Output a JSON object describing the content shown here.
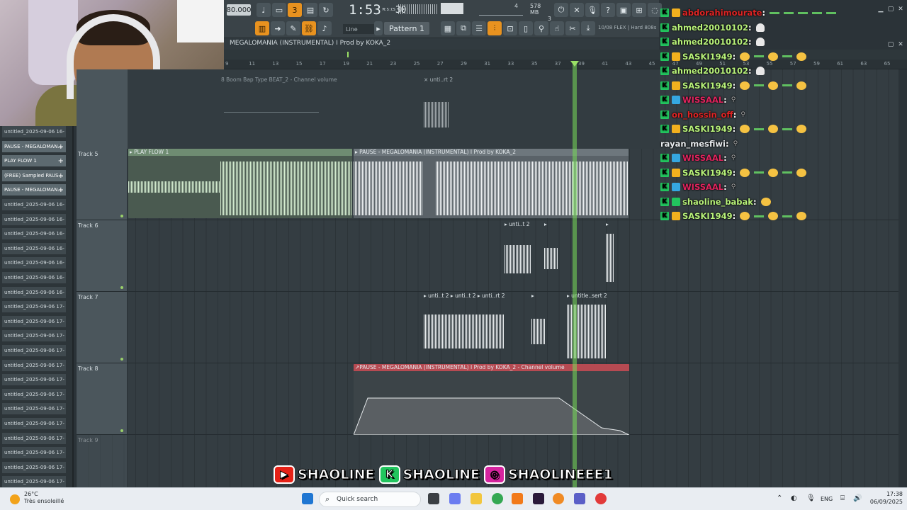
{
  "toolbar": {
    "tempo": "80.000",
    "time": "1:53",
    "time_frac": "30",
    "time_unit": "M:S:CS",
    "memory": "578 MB",
    "memory_sub": "3",
    "cpu_count": "4",
    "pattern": "Pattern 1",
    "snap": "Line",
    "flex_info": "10/08  FLEX | Hard 808s"
  },
  "window_title": "MEGALOMANIA (INSTRUMENTAL) I Prod by KOKA_2",
  "ruler": [
    "9",
    "11",
    "13",
    "15",
    "17",
    "19",
    "21",
    "23",
    "25",
    "27",
    "29",
    "31",
    "33",
    "35",
    "37",
    "39",
    "41",
    "43",
    "45",
    "47",
    "49",
    "51",
    "53",
    "55",
    "57",
    "59",
    "61",
    "63",
    "65"
  ],
  "browser": {
    "items": [
      {
        "label": "untitled_2025-09-06 16-",
        "hl": false
      },
      {
        "label": "PAUSE - MEGALOMAN...",
        "hl": true
      },
      {
        "label": "PLAY FLOW 1",
        "hl": true
      },
      {
        "label": "(FREE) Sampled PAUS...",
        "hl": true
      },
      {
        "label": "PAUSE - MEGALOMAN...",
        "hl": true
      },
      {
        "label": "untitled_2025-09-06 16-",
        "hl": false
      },
      {
        "label": "untitled_2025-09-06 16-",
        "hl": false
      },
      {
        "label": "untitled_2025-09-06 16-",
        "hl": false
      },
      {
        "label": "untitled_2025-09-06 16-",
        "hl": false
      },
      {
        "label": "untitled_2025-09-06 16-",
        "hl": false
      },
      {
        "label": "untitled_2025-09-06 16-",
        "hl": false
      },
      {
        "label": "untitled_2025-09-06 16-",
        "hl": false
      },
      {
        "label": "untitled_2025-09-06 17-",
        "hl": false
      },
      {
        "label": "untitled_2025-09-06 17-",
        "hl": false
      },
      {
        "label": "untitled_2025-09-06 17-",
        "hl": false
      },
      {
        "label": "untitled_2025-09-06 17-",
        "hl": false
      },
      {
        "label": "untitled_2025-09-06 17-",
        "hl": false
      },
      {
        "label": "untitled_2025-09-06 17-",
        "hl": false
      },
      {
        "label": "untitled_2025-09-06 17-",
        "hl": false
      },
      {
        "label": "untitled_2025-09-06 17-",
        "hl": false
      },
      {
        "label": "untitled_2025-09-06 17-",
        "hl": false
      },
      {
        "label": "untitled_2025-09-06 17-",
        "hl": false
      },
      {
        "label": "untitled_2025-09-06 17-",
        "hl": false
      },
      {
        "label": "untitled_2025-09-06 17-",
        "hl": false
      },
      {
        "label": "untitled_2025-09-06 17-",
        "hl": false
      }
    ]
  },
  "tracks": {
    "t5": "Track 5",
    "t6": "Track 6",
    "t7": "Track 7",
    "t8": "Track 8",
    "t9": "Track 9"
  },
  "clips": {
    "automation_top": "8 Boom Bap Type BEAT_2 - Channel volume",
    "top_small": "× unti..rt 2",
    "play_flow": "▸ PLAY FLOW 1",
    "pause_main": "▸ PAUSE - MEGALOMANIA (INSTRUMENTAL) I Prod by KOKA_2",
    "t6_a": "▸ unti..t 2",
    "t6_b": "▸",
    "t6_c": "▸",
    "t7_a": "▸ unti..t 2 ▸ unti..t 2 ▸ unti..rt 2",
    "t7_b": "▸",
    "t7_c": "▸ untitle..sert 2",
    "t8_auto": "↗PAUSE - MEGALOMANIA (INSTRUMENTAL) I Prod by KOKA_2 - Channel volume"
  },
  "chat": [
    {
      "name": "abdorahimourate",
      "color": "#e02424",
      "k": true,
      "badge": "gold",
      "tail": "dashes"
    },
    {
      "name": "ahmed20010102",
      "color": "#b8f27a",
      "k": true,
      "badge": null,
      "tail": "ghost"
    },
    {
      "name": "ahmed20010102",
      "color": "#b8f27a",
      "k": true,
      "badge": null,
      "tail": "ghost"
    },
    {
      "name": "SASKI1949",
      "color": "#b8f27a",
      "k": true,
      "badge": "gold",
      "tail": "emotes"
    },
    {
      "name": "ahmed20010102",
      "color": "#b8f27a",
      "k": true,
      "badge": null,
      "tail": "ghost"
    },
    {
      "name": "SASKI1949",
      "color": "#b8f27a",
      "k": true,
      "badge": "gold",
      "tail": "emotes"
    },
    {
      "name": "WISSAAL",
      "color": "#e0245e",
      "k": true,
      "badge": "blue",
      "tail": "small"
    },
    {
      "name": "on_hossin_off",
      "color": "#e02424",
      "k": true,
      "badge": null,
      "tail": "small"
    },
    {
      "name": "SASKI1949",
      "color": "#b8f27a",
      "k": true,
      "badge": "gold",
      "tail": "emotes"
    },
    {
      "name": "rayan_mesfiwi",
      "color": "#e8ecef",
      "k": false,
      "badge": null,
      "tail": "small"
    },
    {
      "name": "WISSAAL",
      "color": "#e0245e",
      "k": true,
      "badge": "blue",
      "tail": "small"
    },
    {
      "name": "SASKI1949",
      "color": "#b8f27a",
      "k": true,
      "badge": "gold",
      "tail": "emotes"
    },
    {
      "name": "WISSAAL",
      "color": "#e0245e",
      "k": true,
      "badge": "blue",
      "tail": "small"
    },
    {
      "name": "shaoline_babak",
      "color": "#b8f27a",
      "k": true,
      "badge": "green",
      "tail": "one"
    },
    {
      "name": "SASKI1949",
      "color": "#b8f27a",
      "k": true,
      "badge": "gold",
      "tail": "emotes"
    }
  ],
  "socials": [
    {
      "platform": "youtube-icon",
      "handle": "SHAOLINE",
      "color": "#e62117"
    },
    {
      "platform": "kick-icon",
      "handle": "SHAOLINE",
      "color": "#22c55e"
    },
    {
      "platform": "instagram-icon",
      "handle": "SHAOLINEEE1",
      "color": "#d6249f"
    }
  ],
  "taskbar": {
    "temp": "26°C",
    "weather": "Très ensoleillé",
    "search": "Quick search",
    "lang": "ENG",
    "time": "17:38",
    "date": "06/09/2025"
  }
}
